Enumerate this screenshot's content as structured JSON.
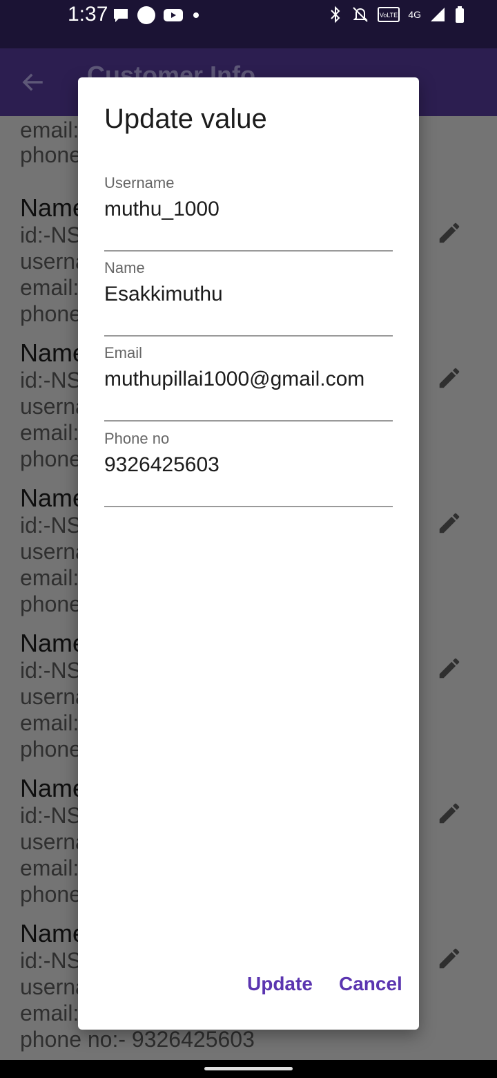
{
  "status_bar": {
    "time": "1:37",
    "left_icons": [
      "message-icon",
      "circle-icon",
      "youtube-icon",
      "dot-icon"
    ],
    "right_icons": [
      "bluetooth-icon",
      "mute-icon",
      "volte-icon",
      "4g-icon",
      "signal-icon",
      "battery-icon"
    ],
    "volte_label": "VoLTE",
    "network_label": "4G"
  },
  "app_bar": {
    "title": "Customer Info"
  },
  "list": {
    "items": [
      {
        "name": "Name",
        "id": "id:-NS",
        "username": "userna",
        "email": "email:",
        "phone": "phone"
      },
      {
        "name": "Name",
        "id": "id:-NS",
        "username": "userna",
        "email": "email:",
        "phone": "phone"
      },
      {
        "name": "Name",
        "id": "id:-NS",
        "username": "userna",
        "email": "email:",
        "phone": "phone"
      },
      {
        "name": "Name",
        "id": "id:-NS",
        "username": "userna",
        "email": "email:",
        "phone": "phone"
      },
      {
        "name": "Name",
        "id": "id:-NS",
        "username": "userna",
        "email": "email:",
        "phone": "phone"
      },
      {
        "name": "Name",
        "id": "id:-NS",
        "username": "userna",
        "email": "email:",
        "phone": "phone no:- 9326425603"
      }
    ],
    "partial_top": {
      "username": "userna",
      "email": "email:",
      "phone": "phone"
    }
  },
  "dialog": {
    "title": "Update value",
    "fields": [
      {
        "label": "Username",
        "value": "muthu_1000"
      },
      {
        "label": "Name",
        "value": "Esakkimuthu"
      },
      {
        "label": "Email",
        "value": "muthupillai1000@gmail.com"
      },
      {
        "label": "Phone no",
        "value": "9326425603"
      }
    ],
    "update_label": "Update",
    "cancel_label": "Cancel"
  }
}
